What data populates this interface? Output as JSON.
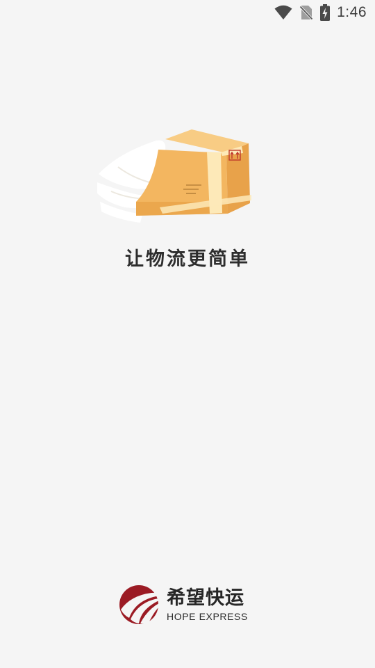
{
  "status_bar": {
    "time": "1:46",
    "icons": [
      "wifi-icon",
      "no-sim-icon",
      "battery-charging-icon"
    ]
  },
  "hero": {
    "illustration": "delivery-box-illustration",
    "tagline": "让物流更简单"
  },
  "brand": {
    "name_cn": "希望快运",
    "name_en": "HOPE EXPRESS",
    "logo": "hope-express-logo",
    "color": "#9b1b24"
  },
  "colors": {
    "background": "#f5f5f5",
    "box": "#f3b660",
    "tape": "#fde9b8"
  }
}
